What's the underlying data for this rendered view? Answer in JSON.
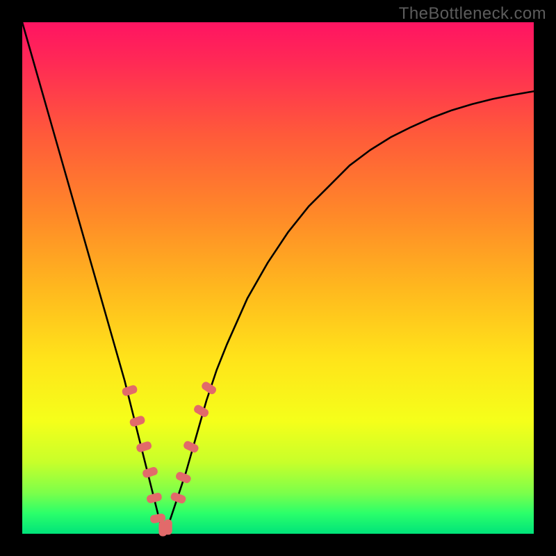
{
  "watermark": {
    "text": "TheBottleneck.com"
  },
  "chart_data": {
    "type": "line",
    "title": "",
    "xlabel": "",
    "ylabel": "",
    "xlim": [
      0,
      100
    ],
    "ylim": [
      0,
      100
    ],
    "series": [
      {
        "name": "curve",
        "x": [
          0,
          2,
          4,
          6,
          8,
          10,
          12,
          14,
          16,
          18,
          20,
          22,
          24,
          26,
          27,
          28,
          30,
          32,
          34,
          36,
          38,
          40,
          44,
          48,
          52,
          56,
          60,
          64,
          68,
          72,
          76,
          80,
          84,
          88,
          92,
          96,
          100
        ],
        "y": [
          100,
          93,
          86,
          79,
          72,
          65,
          58,
          51,
          44,
          37,
          30,
          22,
          14,
          6,
          2,
          0,
          6,
          12,
          19,
          26,
          32,
          37,
          46,
          53,
          59,
          64,
          68,
          72,
          75,
          77.5,
          79.5,
          81.3,
          82.8,
          84,
          85,
          85.8,
          86.5
        ]
      }
    ],
    "markers": [
      {
        "x": 21.0,
        "y": 28.0,
        "angle": 72
      },
      {
        "x": 22.5,
        "y": 22.0,
        "angle": 72
      },
      {
        "x": 23.8,
        "y": 17.0,
        "angle": 72
      },
      {
        "x": 25.0,
        "y": 12.0,
        "angle": 72
      },
      {
        "x": 25.8,
        "y": 7.0,
        "angle": 74
      },
      {
        "x": 26.5,
        "y": 3.0,
        "angle": 80
      },
      {
        "x": 27.5,
        "y": 1.0,
        "angle": 0
      },
      {
        "x": 28.5,
        "y": 1.3,
        "angle": 0
      },
      {
        "x": 30.5,
        "y": 7.0,
        "angle": -70
      },
      {
        "x": 31.5,
        "y": 11.0,
        "angle": -68
      },
      {
        "x": 33.0,
        "y": 17.0,
        "angle": -65
      },
      {
        "x": 35.0,
        "y": 24.0,
        "angle": -60
      },
      {
        "x": 36.5,
        "y": 28.5,
        "angle": -57
      }
    ],
    "marker_color": "#e26a6a",
    "curve_color": "#000000"
  }
}
